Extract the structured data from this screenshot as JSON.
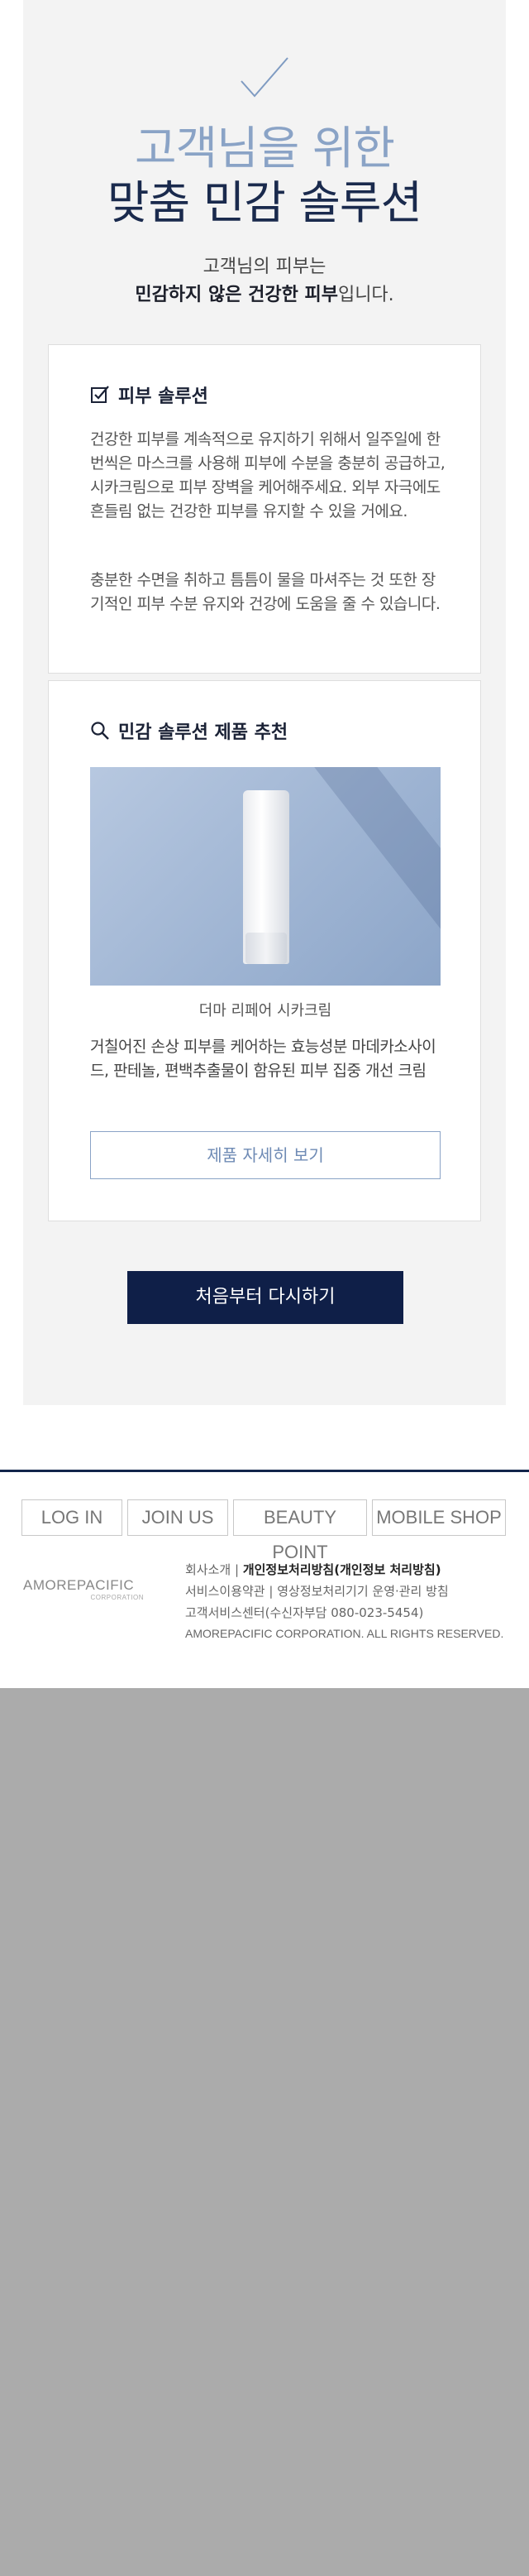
{
  "result": {
    "title_line1": "고객님을 위한",
    "title_line2": "맞춤 민감 솔루션",
    "subtitle_line1": "고객님의 피부는",
    "subtitle_bold": "민감하지 않은 건강한 피부",
    "subtitle_end": "입니다."
  },
  "solution_card": {
    "heading": "피부 솔루션",
    "para1": "건강한 피부를 계속적으로 유지하기 위해서 일주일에 한번씩은 마스크를 사용해 피부에 수분을 충분히 공급하고, 시카크림으로 피부 장벽을 케어해주세요. 외부 자극에도 흔들림 없는 건강한 피부를 유지할 수 있을 거에요.",
    "para2": "충분한 수면을 취하고 틈틈이 물을 마셔주는 것 또한 장기적인 피부 수분 유지와 건강에 도움을 줄 수 있습니다."
  },
  "product_card": {
    "heading": "민감 솔루션 제품 추천",
    "product_name": "더마 리페어 시카크림",
    "description": "거칠어진 손상 피부를 케어하는 효능성분 마데카소사이드, 판테놀, 편백추출물이 함유된 피부 집중 개선 크림",
    "detail_button": "제품 자세히 보기"
  },
  "restart_button": "처음부터 다시하기",
  "footer": {
    "nav": [
      "LOG IN",
      "JOIN US",
      "BEAUTY POINT",
      "MOBILE SHOP"
    ],
    "logo_main": "AMOREPACIFIC",
    "logo_sub": "CORPORATION",
    "link_company": "회사소개",
    "link_privacy": "개인정보처리방침(개인정보 처리방침)",
    "link_terms": "서비스이용약관",
    "link_cctv": "영상정보처리기기 운영·관리 방침",
    "link_cs": "고객서비스센터(수신자부담 080-023-5454)",
    "copyright": "AMOREPACIFIC CORPORATION. ALL RIGHTS RESERVED."
  },
  "colors": {
    "accent_light": "#8aa3c6",
    "navy": "#0f1f48",
    "gray_bg": "#ababab"
  }
}
